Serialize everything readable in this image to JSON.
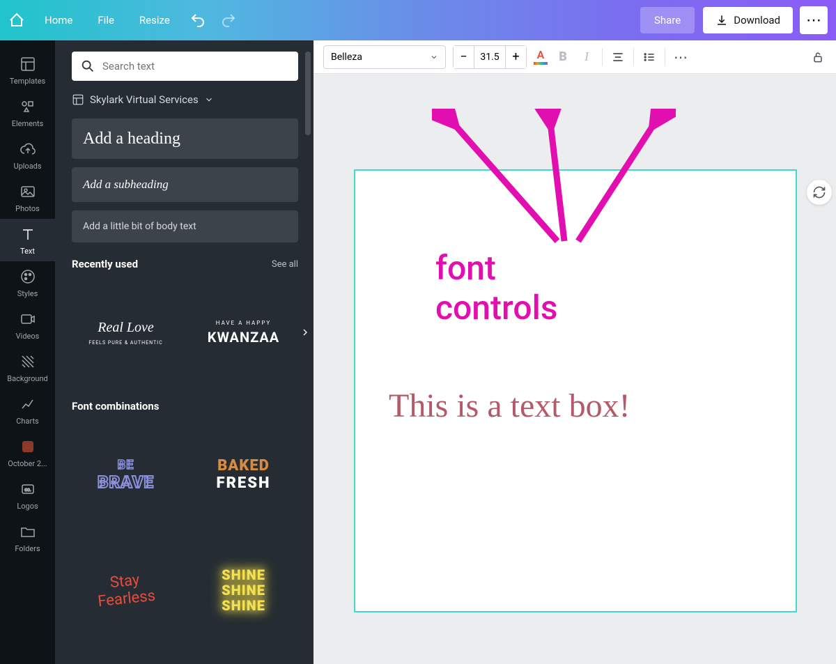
{
  "topbar": {
    "home": "Home",
    "file": "File",
    "resize": "Resize",
    "share": "Share",
    "download": "Download"
  },
  "rail": {
    "templates": "Templates",
    "elements": "Elements",
    "uploads": "Uploads",
    "photos": "Photos",
    "text": "Text",
    "styles": "Styles",
    "videos": "Videos",
    "background": "Background",
    "charts": "Charts",
    "october": "October 2...",
    "logos": "Logos",
    "folders": "Folders"
  },
  "panel": {
    "search_placeholder": "Search text",
    "brand": "Skylark Virtual Services",
    "heading": "Add a heading",
    "subheading": "Add a subheading",
    "body": "Add a little bit of body text",
    "recent_title": "Recently used",
    "see_all": "See all",
    "fontcombo_title": "Font combinations",
    "thumbs": {
      "real_love": "Real Love",
      "real_love_sub": "FEELS PURE & AUTHENTIC",
      "kwanzaa_top": "HAVE A HAPPY",
      "kwanzaa": "KWANZAA",
      "be": "BE",
      "brave": "BRAVE",
      "baked": "BAKED",
      "fresh": "FRESH",
      "stay": "Stay",
      "fearless": "Fearless",
      "shine": "SHINE"
    }
  },
  "toolbar": {
    "font": "Belleza",
    "size": "31.5"
  },
  "canvas": {
    "textbox": "This is a text box!"
  },
  "annotation": {
    "label": "font controls"
  }
}
